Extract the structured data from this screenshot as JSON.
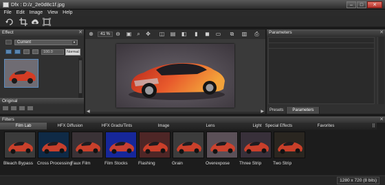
{
  "window": {
    "title": "Dfx : D:/z_2e0d8c1f.jpg",
    "controls": {
      "minimize": "–",
      "maximize": "□",
      "close": "✕"
    }
  },
  "menu": [
    "File",
    "Edit",
    "Image",
    "View",
    "Help"
  ],
  "toolbar_icons": [
    "rotate-icon",
    "crop-icon",
    "upload-icon",
    "fullscreen-icon"
  ],
  "effect_panel": {
    "title": "Effect",
    "layer_select": "Current",
    "opacity": "100.0",
    "blend_mode": "Normal",
    "original_label": "Original"
  },
  "view_toolbar": {
    "zoom": "41 %",
    "icons": [
      "zoom-in-icon",
      "zoom-out-icon",
      "fit-icon",
      "magnify-icon",
      "pan-icon",
      "split-vertical-icon",
      "split-horizontal-icon",
      "compare-icon",
      "single-view-icon",
      "mask-icon",
      "monitor-icon",
      "before-after-icon",
      "histogram-icon",
      "print-icon"
    ]
  },
  "parameters_panel": {
    "title": "Parameters",
    "tabs": [
      "Presets",
      "Parameters"
    ],
    "active_tab": "Parameters"
  },
  "filters_panel": {
    "title": "Filters",
    "tabs": [
      "Film Lab",
      "HFX Diffusion",
      "HFX Grads/Tints",
      "Image",
      "Lens",
      "Light",
      "Special Effects",
      "Favorites"
    ],
    "active_tab": "Film Lab",
    "items": [
      {
        "label": "Bleach Bypass",
        "tint": "#3b3b3b"
      },
      {
        "label": "Cross Processing",
        "tint": "#0f2a46"
      },
      {
        "label": "Faux Film",
        "tint": "#3a3236"
      },
      {
        "label": "Film Stocks",
        "tint": "#16279a"
      },
      {
        "label": "Flashing",
        "tint": "#4e2626"
      },
      {
        "label": "Grain",
        "tint": "#3c3c3c"
      },
      {
        "label": "Overexpose",
        "tint": "#5b5058"
      },
      {
        "label": "Three Strip",
        "tint": "#38303a"
      },
      {
        "label": "Two Strip",
        "tint": "#2a2620"
      }
    ]
  },
  "status": {
    "dimensions": "1280 x 720 (8 bits)"
  },
  "colors": {
    "accent": "#5c8dc0",
    "car": "#e2452a"
  }
}
